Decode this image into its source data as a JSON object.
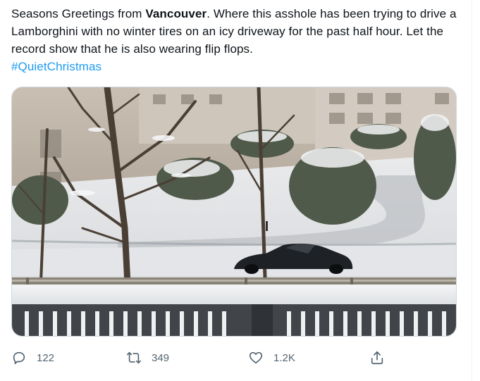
{
  "tweet": {
    "text_before": "Seasons Greetings from ",
    "bold_city": "Vancouver",
    "text_after": ". Where this asshole has been trying to drive a Lamborghini with no winter tires on an icy driveway for the past half hour. Let the record show that he is also wearing flip flops.",
    "hashtag": "#QuietChristmas"
  },
  "actions": {
    "reply_count": "122",
    "retweet_count": "349",
    "like_count": "1.2K"
  },
  "icons": {
    "reply": "reply-bubble-icon",
    "retweet": "retweet-arrows-icon",
    "like": "heart-icon",
    "share": "share-upload-icon"
  },
  "colors": {
    "text": "#0f1419",
    "secondary": "#536471",
    "link": "#1d9bf0",
    "border": "#cfd9de"
  }
}
